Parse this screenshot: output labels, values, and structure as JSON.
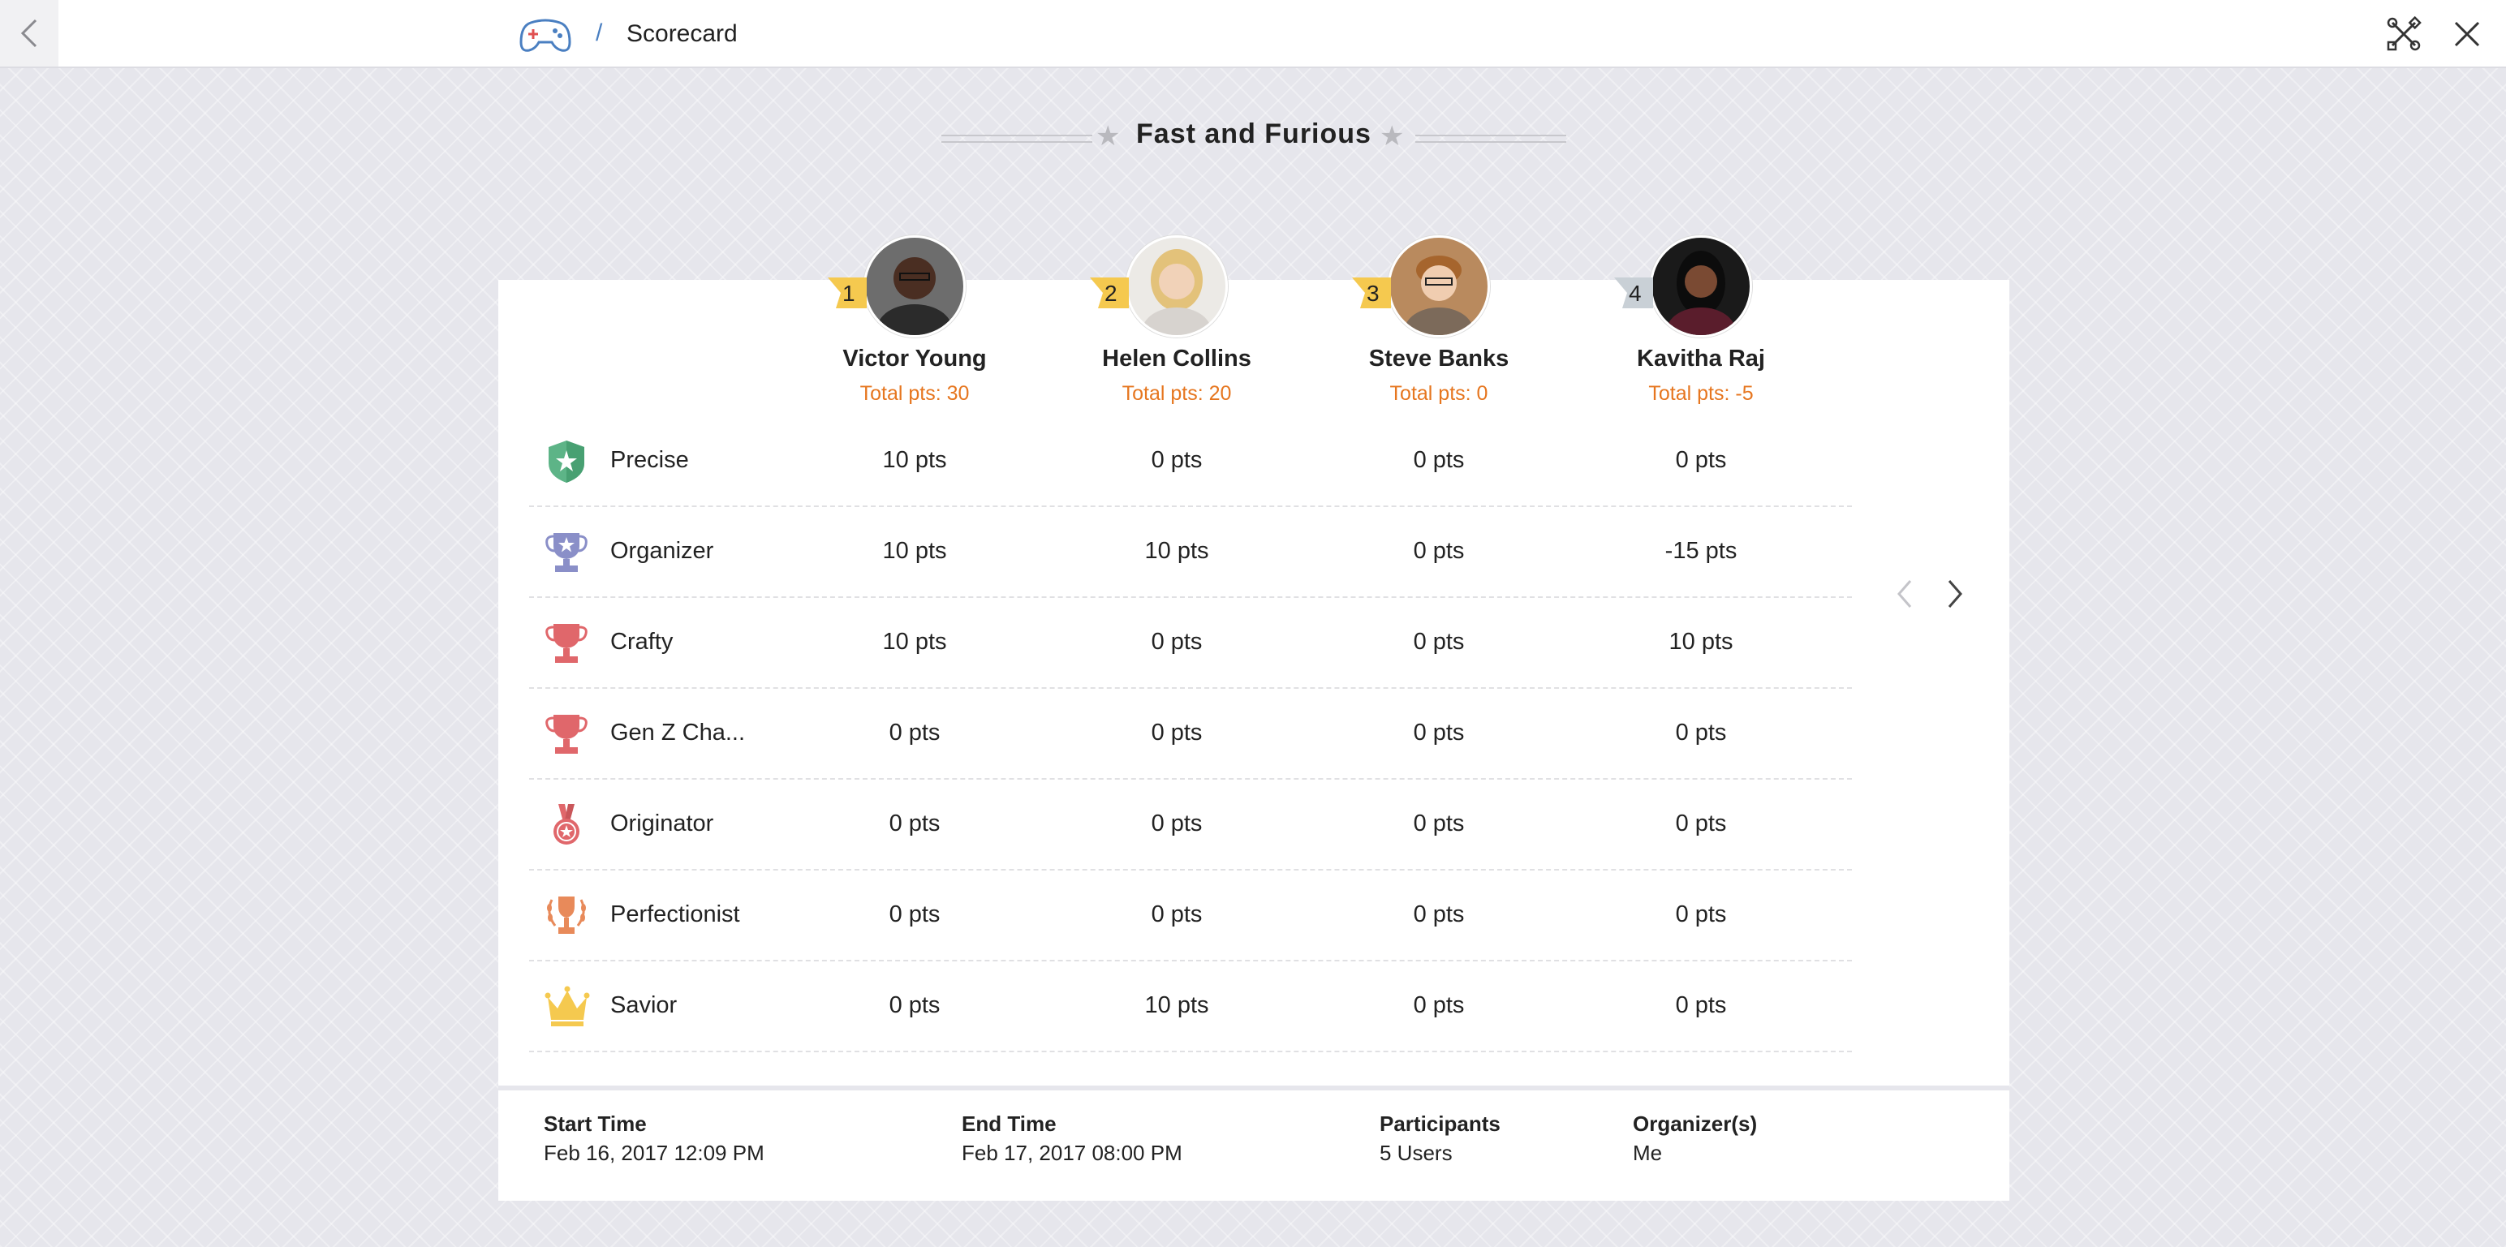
{
  "header": {
    "separator": "/",
    "title": "Scorecard"
  },
  "contest": {
    "name": "Fast and Furious"
  },
  "participants": [
    {
      "rank": "1",
      "name": "Victor Young",
      "total": "Total pts: 30",
      "rank_color": "#f5c94f"
    },
    {
      "rank": "2",
      "name": "Helen Collins",
      "total": "Total pts: 20",
      "rank_color": "#f5c94f"
    },
    {
      "rank": "3",
      "name": "Steve Banks",
      "total": "Total pts: 0",
      "rank_color": "#f5c94f"
    },
    {
      "rank": "4",
      "name": "Kavitha Raj",
      "total": "Total pts: -5",
      "rank_color": "#c9d0d6"
    }
  ],
  "badges": [
    {
      "name": "Precise",
      "icon": "shield-icon",
      "points": [
        "10 pts",
        "0 pts",
        "0 pts",
        "0 pts"
      ]
    },
    {
      "name": "Organizer",
      "icon": "star-trophy-icon",
      "points": [
        "10 pts",
        "10 pts",
        "0 pts",
        "-15 pts"
      ]
    },
    {
      "name": "Crafty",
      "icon": "trophy-icon",
      "points": [
        "10 pts",
        "0 pts",
        "0 pts",
        "10 pts"
      ]
    },
    {
      "name": "Gen Z Cha...",
      "icon": "trophy-icon",
      "points": [
        "0 pts",
        "0 pts",
        "0 pts",
        "0 pts"
      ]
    },
    {
      "name": "Originator",
      "icon": "medal-icon",
      "points": [
        "0 pts",
        "0 pts",
        "0 pts",
        "0 pts"
      ]
    },
    {
      "name": "Perfectionist",
      "icon": "laurel-trophy-icon",
      "points": [
        "0 pts",
        "0 pts",
        "0 pts",
        "0 pts"
      ]
    },
    {
      "name": "Savior",
      "icon": "crown-icon",
      "points": [
        "0 pts",
        "10 pts",
        "0 pts",
        "0 pts"
      ]
    }
  ],
  "footer": {
    "start_label": "Start Time",
    "start_value": "Feb 16, 2017 12:09 PM",
    "end_label": "End Time",
    "end_value": "Feb 17, 2017 08:00 PM",
    "participants_label": "Participants",
    "participants_value": "5 Users",
    "organizers_label": "Organizer(s)",
    "organizers_value": "Me"
  },
  "colors": {
    "accent_orange": "#e6761f",
    "link_blue": "#4a7fc1"
  }
}
